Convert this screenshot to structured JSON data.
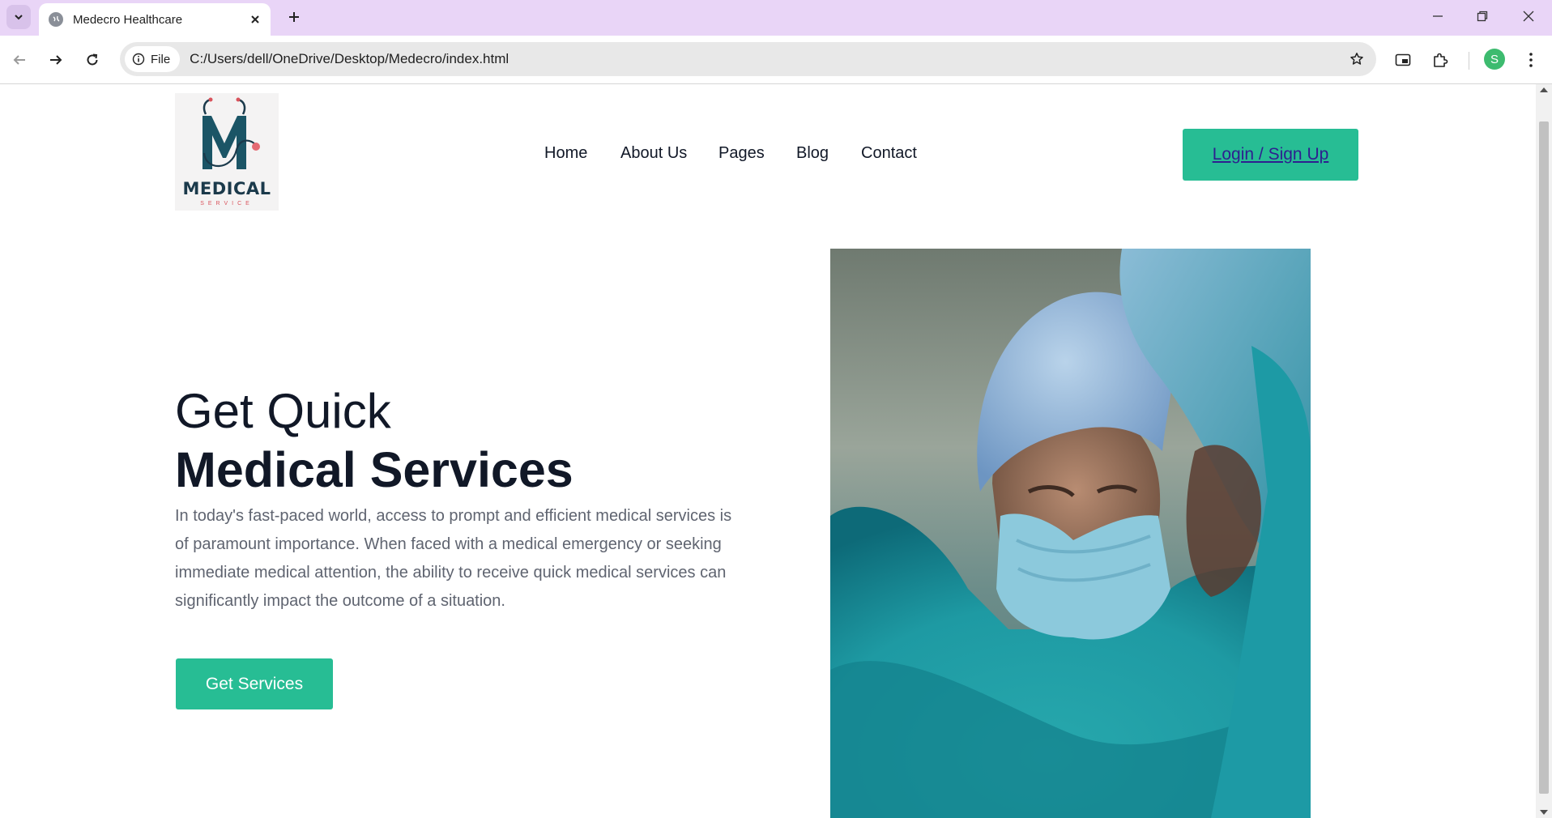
{
  "browser": {
    "tab_title": "Medecro Healthcare",
    "url_chip_label": "File",
    "url": "C:/Users/dell/OneDrive/Desktop/Medecro/index.html",
    "profile_initial": "S",
    "accent_color": "#e9d5f7"
  },
  "site": {
    "logo": {
      "word": "MEDICAL",
      "sub": "SERVICE"
    },
    "nav": [
      "Home",
      "About Us",
      "Pages",
      "Blog",
      "Contact"
    ],
    "login_label": "Login / Sign Up",
    "brand_color": "#27bd94"
  },
  "hero": {
    "line1": "Get Quick",
    "line2": "Medical Services",
    "description": "In today's fast-paced world, access to prompt and efficient medical services is of paramount importance. When faced with a medical emergency or seeking immediate medical attention, the ability to receive quick medical services can significantly impact the outcome of a situation.",
    "cta_label": "Get Services",
    "image_icon": "surgeon-photo"
  }
}
